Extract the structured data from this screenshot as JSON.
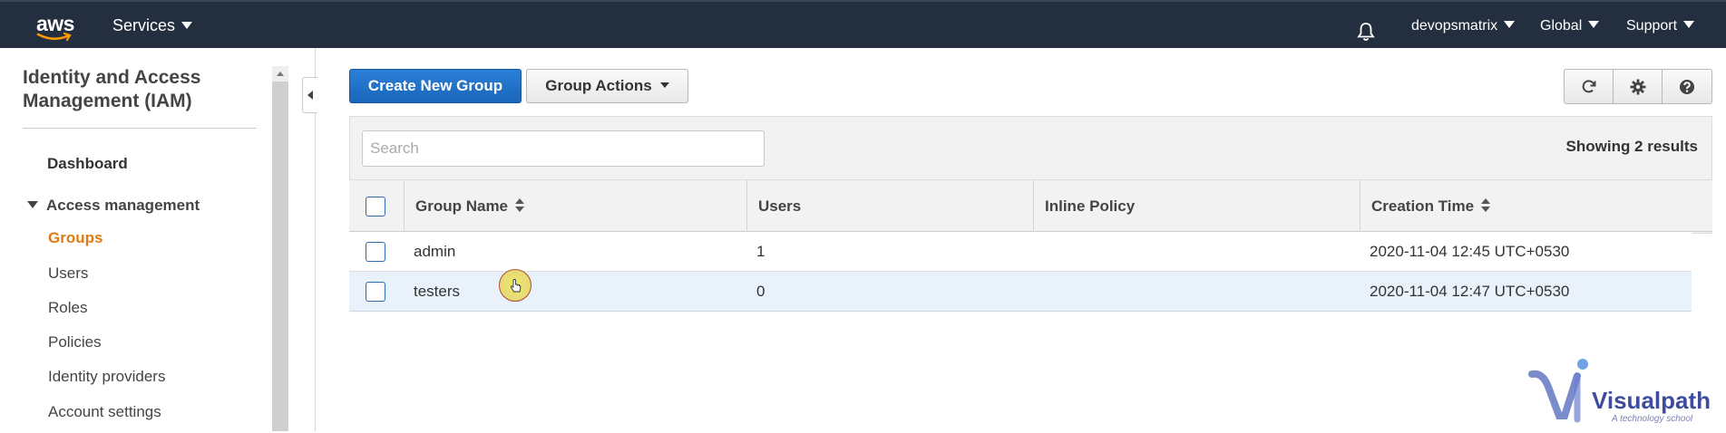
{
  "topnav": {
    "logo_text": "aws",
    "services_label": "Services",
    "bell_icon": "bell-icon",
    "user_label": "devopsmatrix",
    "region_label": "Global",
    "support_label": "Support"
  },
  "sidebar": {
    "title": "Identity and Access Management (IAM)",
    "dashboard_label": "Dashboard",
    "section_label": "Access management",
    "items": [
      {
        "label": "Groups",
        "active": true
      },
      {
        "label": "Users",
        "active": false
      },
      {
        "label": "Roles",
        "active": false
      },
      {
        "label": "Policies",
        "active": false
      },
      {
        "label": "Identity providers",
        "active": false
      },
      {
        "label": "Account settings",
        "active": false
      }
    ]
  },
  "toolbar": {
    "create_label": "Create New Group",
    "actions_label": "Group Actions",
    "refresh_icon": "refresh-icon",
    "settings_icon": "gear-icon",
    "help_icon": "help-icon"
  },
  "table": {
    "search_placeholder": "Search",
    "results_text": "Showing 2 results",
    "columns": [
      "Group Name",
      "Users",
      "Inline Policy",
      "Creation Time"
    ],
    "rows": [
      {
        "name": "admin",
        "users": "1",
        "inline_policy": "",
        "created": "2020-11-04 12:45 UTC+0530",
        "highlighted": false
      },
      {
        "name": "testers",
        "users": "0",
        "inline_policy": "",
        "created": "2020-11-04 12:47 UTC+0530",
        "highlighted": true
      }
    ]
  },
  "watermark": {
    "brand": "Visualpath",
    "tagline": "A technology school"
  },
  "colors": {
    "nav_bg": "#232f3e",
    "primary": "#1f6fc5",
    "active_link": "#dd7a13",
    "selected_row": "#e9f2fb"
  }
}
